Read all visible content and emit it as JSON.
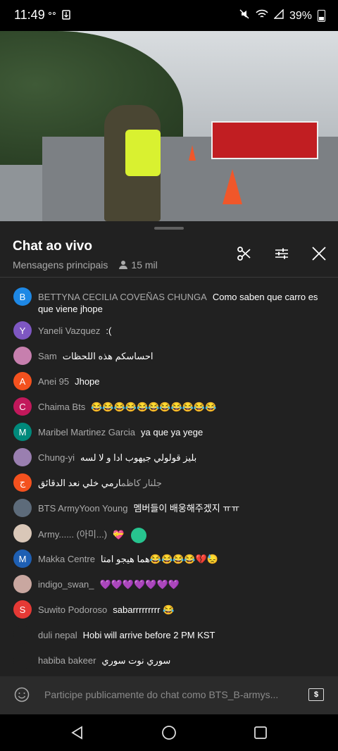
{
  "status_bar": {
    "time": "11:49",
    "left_icons": [
      "voicemail-icon",
      "uninstall-icon"
    ],
    "battery": "39%"
  },
  "video": {
    "scene": "roadside-soldier-with-baton"
  },
  "chat": {
    "title": "Chat ao vivo",
    "filter": "Mensagens principais",
    "viewers": "15 mil",
    "messages": [
      {
        "author": "BETTYNA CECILIA COVEÑAS CHUNGA",
        "text": "Como saben que carro es que viene jhope",
        "initial": "B",
        "color": "#1e88e5"
      },
      {
        "author": "Yaneli Vazquez",
        "text": ":(",
        "initial": "Y",
        "color": "#7e57c2"
      },
      {
        "author": "Sam",
        "text": "احساسكم هذه اللحظات",
        "initial": "",
        "color": "#c77fae"
      },
      {
        "author": "Anei 95",
        "text": "Jhope",
        "initial": "A",
        "color": "#f4511e"
      },
      {
        "author": "Chaima Bts",
        "text": "😂😂😂😂😂😂😂😂😂😂😂",
        "initial": "C",
        "color": "#c2185b"
      },
      {
        "author": "Maribel Martinez Garcia",
        "text": "ya que ya yege",
        "initial": "M",
        "color": "#00897b"
      },
      {
        "author": "Chung-yi",
        "text": "بليز قولولي جيهوب ادا و لا لسه",
        "initial": "",
        "color": "#9a7fb0"
      },
      {
        "author": "جلنار كاظم",
        "text": "ارمي خلي نعد الدقائق",
        "initial": "ج",
        "color": "#f4511e"
      },
      {
        "author": "BTS ArmyYoon Young",
        "text": "멤버들이 배웅해주겠지 ㅠㅠ",
        "initial": "",
        "color": "#5d6b7a"
      },
      {
        "author": "Army...... (아미...)",
        "text": "💝",
        "initial": "",
        "color": "#d9c7b8"
      },
      {
        "author": "Makka Centre",
        "text": "هما هيجو امتا😂😂😂😂💔😓",
        "initial": "M",
        "color": "#1e5fb3"
      },
      {
        "author": "indigo_swan_",
        "text": "💜💜💜💜💜💜💜",
        "initial": "",
        "color": "#c9a7a0"
      },
      {
        "author": "Suwito Podoroso",
        "text": "sabarrrrrrrrr 😂",
        "initial": "S",
        "color": "#e53935"
      },
      {
        "author": "duli nepal",
        "text": "Hobi will arrive before 2 PM KST",
        "initial": "",
        "color": "#212121"
      },
      {
        "author": "habiba bakeer",
        "text": "سوري نوت سوري",
        "initial": "",
        "color": "#212121"
      }
    ]
  },
  "input": {
    "placeholder": "Participe publicamente do chat como BTS_B-armys..."
  },
  "colors": {
    "panel": "#212121",
    "input_bar": "#2b2b2b",
    "author": "#aaaaaa"
  }
}
